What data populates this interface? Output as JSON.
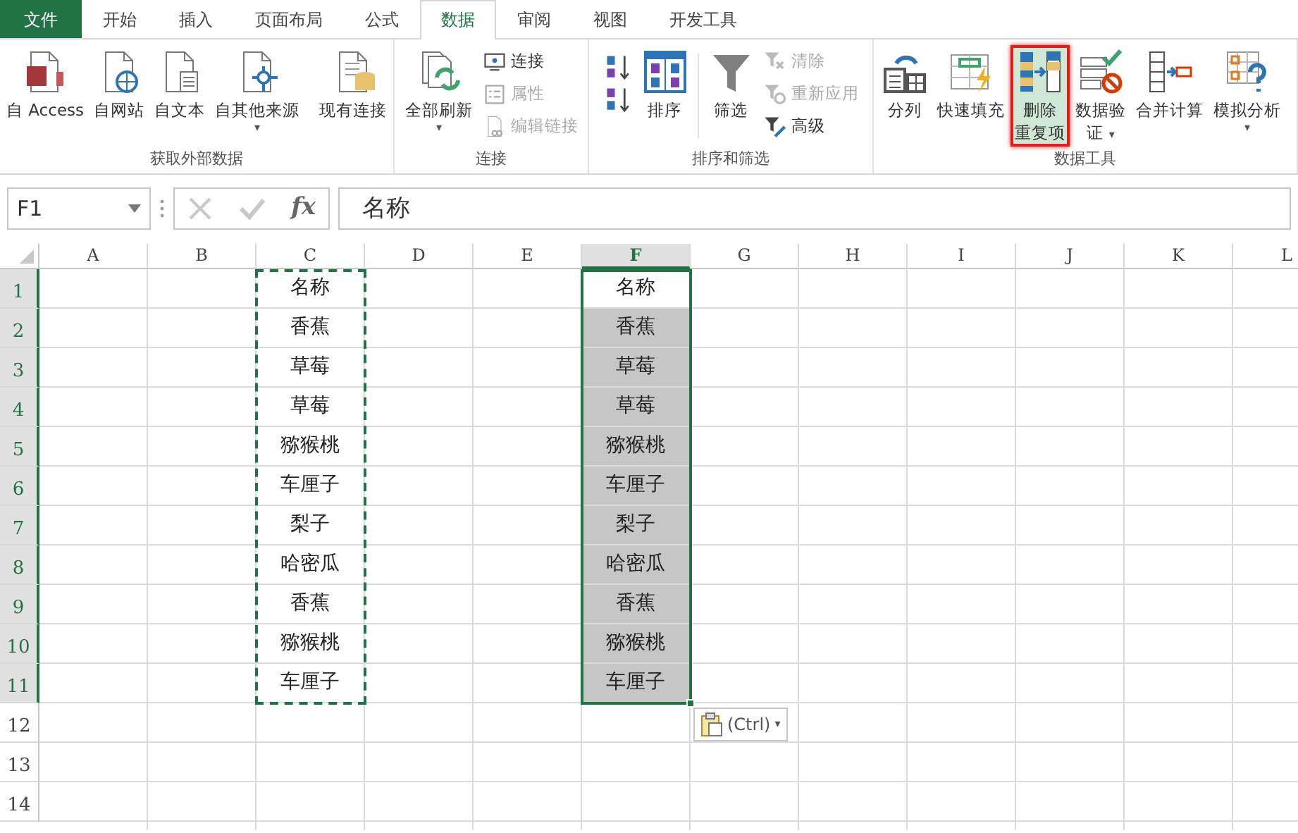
{
  "tabs": [
    {
      "label": "文件",
      "kind": "file",
      "selected": false
    },
    {
      "label": "开始",
      "kind": "tab",
      "selected": false
    },
    {
      "label": "插入",
      "kind": "tab",
      "selected": false
    },
    {
      "label": "页面布局",
      "kind": "tab",
      "selected": false
    },
    {
      "label": "公式",
      "kind": "tab",
      "selected": false
    },
    {
      "label": "数据",
      "kind": "tab",
      "selected": true
    },
    {
      "label": "审阅",
      "kind": "tab",
      "selected": false
    },
    {
      "label": "视图",
      "kind": "tab",
      "selected": false
    },
    {
      "label": "开发工具",
      "kind": "tab",
      "selected": false
    }
  ],
  "ribbon": {
    "groups": [
      {
        "label": "获取外部数据",
        "items": [
          {
            "kind": "large",
            "lines": [
              "自 Access"
            ],
            "highlighted": false
          },
          {
            "kind": "large",
            "lines": [
              "自网站"
            ],
            "highlighted": false
          },
          {
            "kind": "large",
            "lines": [
              "自文本"
            ],
            "highlighted": false
          },
          {
            "kind": "large",
            "lines": [
              "自其他来源"
            ],
            "caret": "▾",
            "highlighted": false
          },
          {
            "kind": "separator"
          },
          {
            "kind": "large",
            "lines": [
              "现有连接"
            ],
            "highlighted": false
          }
        ]
      },
      {
        "label": "连接",
        "items": [
          {
            "kind": "large",
            "lines": [
              "全部刷新"
            ],
            "caret": "▾",
            "highlighted": false
          },
          {
            "kind": "stack",
            "items": [
              {
                "label": "连接",
                "disabled": false
              },
              {
                "label": "属性",
                "disabled": true
              },
              {
                "label": "编辑链接",
                "disabled": true
              }
            ]
          }
        ]
      },
      {
        "label": "排序和筛选",
        "items": [
          {
            "kind": "stack",
            "items": [
              {
                "disabled": false
              },
              {
                "disabled": false
              }
            ]
          },
          {
            "kind": "large",
            "lines": [
              "排序"
            ],
            "highlighted": false
          },
          {
            "kind": "separator"
          },
          {
            "kind": "large",
            "lines": [
              "筛选"
            ],
            "highlighted": false
          },
          {
            "kind": "stack",
            "items": [
              {
                "label": "清除",
                "disabled": true
              },
              {
                "label": "重新应用",
                "disabled": true
              },
              {
                "label": "高级",
                "disabled": false
              }
            ]
          }
        ]
      },
      {
        "label": "数据工具",
        "items": [
          {
            "kind": "large",
            "lines": [
              "分列"
            ],
            "highlighted": false
          },
          {
            "kind": "large",
            "lines": [
              "快速填充"
            ],
            "highlighted": false
          },
          {
            "kind": "large",
            "lines": [
              "删除",
              "重复项"
            ],
            "highlighted": true
          },
          {
            "kind": "large",
            "lines": [
              "数据验",
              "证"
            ],
            "caret": "▾",
            "highlighted": false
          },
          {
            "kind": "large",
            "lines": [
              "合并计算"
            ],
            "highlighted": false
          },
          {
            "kind": "large",
            "lines": [
              "模拟分析"
            ],
            "caret": "▾",
            "highlighted": false
          }
        ]
      }
    ]
  },
  "formula_bar": {
    "name_box": "F1",
    "function_button": "fx",
    "formula": "名称"
  },
  "sheet": {
    "columns": [
      {
        "label": "A",
        "selected": false
      },
      {
        "label": "B",
        "selected": false
      },
      {
        "label": "C",
        "selected": false,
        "copied": true,
        "cells": [
          "名称",
          "香蕉",
          "草莓",
          "草莓",
          "猕猴桃",
          "车厘子",
          "梨子",
          "哈密瓜",
          "香蕉",
          "猕猴桃",
          "车厘子"
        ]
      },
      {
        "label": "D",
        "selected": false
      },
      {
        "label": "E",
        "selected": false
      },
      {
        "label": "F",
        "selected": true,
        "copied": false,
        "cells": [
          "名称",
          "香蕉",
          "草莓",
          "草莓",
          "猕猴桃",
          "车厘子",
          "梨子",
          "哈密瓜",
          "香蕉",
          "猕猴桃",
          "车厘子"
        ]
      },
      {
        "label": "G",
        "selected": false
      },
      {
        "label": "H",
        "selected": false
      },
      {
        "label": "I",
        "selected": false
      },
      {
        "label": "J",
        "selected": false
      },
      {
        "label": "K",
        "selected": false
      },
      {
        "label": "L",
        "selected": false
      }
    ],
    "rows": [
      {
        "label": "1",
        "selected": true
      },
      {
        "label": "2",
        "selected": true
      },
      {
        "label": "3",
        "selected": true
      },
      {
        "label": "4",
        "selected": true
      },
      {
        "label": "5",
        "selected": true
      },
      {
        "label": "6",
        "selected": true
      },
      {
        "label": "7",
        "selected": true
      },
      {
        "label": "8",
        "selected": true
      },
      {
        "label": "9",
        "selected": true
      },
      {
        "label": "10",
        "selected": true
      },
      {
        "label": "11",
        "selected": true
      },
      {
        "label": "12",
        "selected": false
      },
      {
        "label": "13",
        "selected": false
      },
      {
        "label": "14",
        "selected": false
      }
    ],
    "paste_options": {
      "label": "(Ctrl)",
      "caret": "▾"
    }
  }
}
